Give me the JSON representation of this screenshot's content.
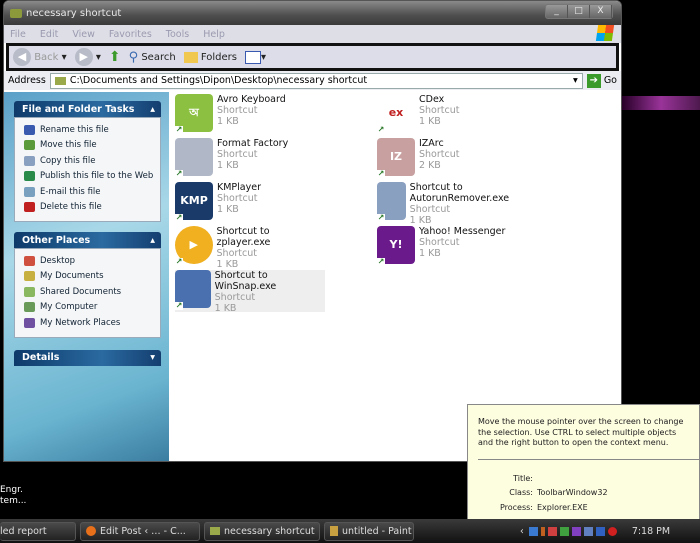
{
  "window": {
    "title": "necessary shortcut",
    "controls": [
      "_",
      "□",
      "X"
    ]
  },
  "menu": [
    "File",
    "Edit",
    "View",
    "Favorites",
    "Tools",
    "Help"
  ],
  "toolbar": {
    "back": "Back",
    "search": "Search",
    "folders": "Folders"
  },
  "address": {
    "label": "Address",
    "path": "C:\\Documents and Settings\\Dipon\\Desktop\\necessary shortcut",
    "go": "Go"
  },
  "tasks": {
    "title": "File and Folder Tasks",
    "items": [
      "Rename this file",
      "Move this file",
      "Copy this file",
      "Publish this file to the Web",
      "E-mail this file",
      "Delete this file"
    ]
  },
  "places": {
    "title": "Other Places",
    "items": [
      "Desktop",
      "My Documents",
      "Shared Documents",
      "My Computer",
      "My Network Places"
    ]
  },
  "details": {
    "title": "Details"
  },
  "files": [
    {
      "name": "Avro Keyboard",
      "type": "Shortcut",
      "size": "1 KB"
    },
    {
      "name": "CDex",
      "type": "Shortcut",
      "size": "1 KB"
    },
    {
      "name": "Format Factory",
      "type": "Shortcut",
      "size": "1 KB"
    },
    {
      "name": "IZArc",
      "type": "Shortcut",
      "size": "2 KB"
    },
    {
      "name": "KMPlayer",
      "type": "Shortcut",
      "size": "1 KB"
    },
    {
      "name": "Shortcut to AutorunRemover.exe",
      "type": "Shortcut",
      "size": "1 KB"
    },
    {
      "name": "Shortcut to zplayer.exe",
      "type": "Shortcut",
      "size": "1 KB"
    },
    {
      "name": "Yahoo! Messenger",
      "type": "Shortcut",
      "size": "1 KB"
    },
    {
      "name": "Shortcut to WinSnap.exe",
      "type": "Shortcut",
      "size": "1 KB"
    }
  ],
  "desktop": {
    "icon_label_1": "Engr.",
    "icon_label_2": "tem..."
  },
  "taskbar": {
    "items": [
      "led report",
      "Edit Post ‹ … - C...",
      "necessary shortcut",
      "untitled - Paint"
    ],
    "clock": "7:18 PM"
  },
  "tooltip": {
    "text": "Move the mouse pointer over the screen to change the selection. Use CTRL to select multiple objects and the right button to open the context menu.",
    "title_label": "Title:",
    "title_value": "",
    "class_label": "Class:",
    "class_value": "ToolbarWindow32",
    "process_label": "Process:",
    "process_value": "Explorer.EXE"
  }
}
